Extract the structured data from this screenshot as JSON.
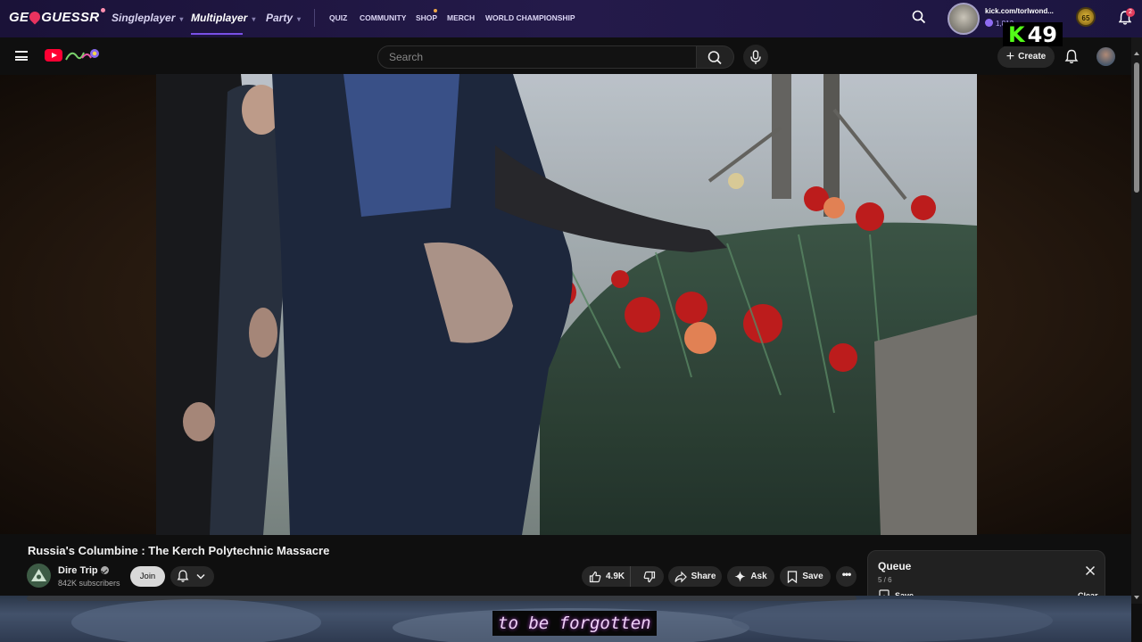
{
  "geoguessr": {
    "logo": "GEOGUESSR",
    "nav": [
      {
        "label": "Singleplayer",
        "active": false
      },
      {
        "label": "Multiplayer",
        "active": true
      },
      {
        "label": "Party",
        "active": false
      }
    ],
    "links": [
      "QUIZ",
      "COMMUNITY",
      "SHOP",
      "MERCH",
      "WORLD CHAMPIONSHIP"
    ],
    "profile_name": "kick.com/torlwond...",
    "coins": "1,812",
    "level": "65",
    "notifications": "2"
  },
  "kick_overlay": {
    "k": "K",
    "number": "49"
  },
  "youtube": {
    "search_placeholder": "Search",
    "create_label": "Create"
  },
  "video": {
    "title": "Russia's Columbine : The Kerch Polytechnic Massacre",
    "channel": "Dire Trip",
    "subscribers": "842K subscribers",
    "join_label": "Join",
    "likes": "4.9K",
    "share_label": "Share",
    "ask_label": "Ask",
    "save_label": "Save",
    "more_label": "•••"
  },
  "queue": {
    "title": "Queue",
    "count": "5 / 6",
    "save_label": "Save",
    "clear_label": "Clear"
  },
  "caption": "to be forgotten",
  "colors": {
    "geo_bar": "#241a4a",
    "geo_accent": "#7950e6",
    "yt_background": "#0f0f0f",
    "youtube_red": "#ff0033",
    "kick_green": "#53fc18",
    "caption_text": "#f0d2f8"
  }
}
